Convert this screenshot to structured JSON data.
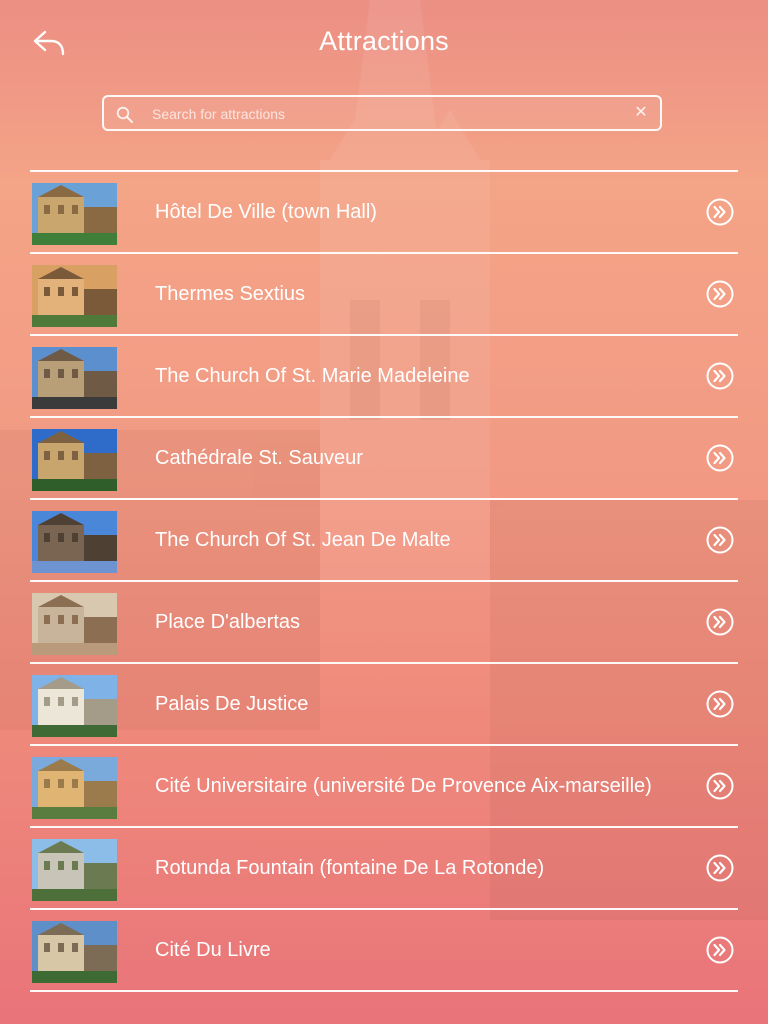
{
  "header": {
    "title": "Attractions"
  },
  "search": {
    "placeholder": "Search for attractions",
    "value": ""
  },
  "attractions": [
    {
      "label": "Hôtel De Ville (town Hall)",
      "thumb": {
        "sky": "#6aa2d8",
        "a": "#c9a66d",
        "b": "#8a6a43",
        "c": "#3f7f3a"
      }
    },
    {
      "label": "Thermes Sextius",
      "thumb": {
        "sky": "#d9a064",
        "a": "#e2b27a",
        "b": "#7b5a3a",
        "c": "#4f7a39"
      }
    },
    {
      "label": "The Church Of St. Marie Madeleine",
      "thumb": {
        "sky": "#5c8fce",
        "a": "#b99f78",
        "b": "#6f5b45",
        "c": "#3b3b3b"
      }
    },
    {
      "label": "Cathédrale St. Sauveur",
      "thumb": {
        "sky": "#2f6bc8",
        "a": "#c9a56e",
        "b": "#7e6140",
        "c": "#2f5e2a"
      }
    },
    {
      "label": "The Church Of St. Jean De Malte",
      "thumb": {
        "sky": "#4b87d9",
        "a": "#7a6552",
        "b": "#4f4034",
        "c": "#6d93d0"
      }
    },
    {
      "label": "Place D'albertas",
      "thumb": {
        "sky": "#d9c8b0",
        "a": "#c8b49a",
        "b": "#8c6e52",
        "c": "#b99b7c"
      }
    },
    {
      "label": "Palais De Justice",
      "thumb": {
        "sky": "#7fb2e6",
        "a": "#ece6d8",
        "b": "#a49b89",
        "c": "#3f6a35"
      }
    },
    {
      "label": "Cité Universitaire (université De Provence Aix-marseille)",
      "thumb": {
        "sky": "#7aa9dc",
        "a": "#e0b574",
        "b": "#9b7a4c",
        "c": "#587d3e"
      }
    },
    {
      "label": "Rotunda Fountain (fontaine De La Rotonde)",
      "thumb": {
        "sky": "#8cbce8",
        "a": "#c9c4b8",
        "b": "#6c7a52",
        "c": "#4d6f3a"
      }
    },
    {
      "label": "Cité Du Livre",
      "thumb": {
        "sky": "#5f8fc9",
        "a": "#d8c7a6",
        "b": "#7c6b55",
        "c": "#3e6b33"
      }
    }
  ],
  "icons": {
    "back": "back-arrow-icon",
    "search": "magnifier-icon",
    "clear": "close-icon",
    "row_action": "double-chevron-right-icon"
  },
  "colors": {
    "foreground": "#ffffff",
    "bg_top": "#f4a487",
    "bg_bottom": "#e9747a"
  }
}
